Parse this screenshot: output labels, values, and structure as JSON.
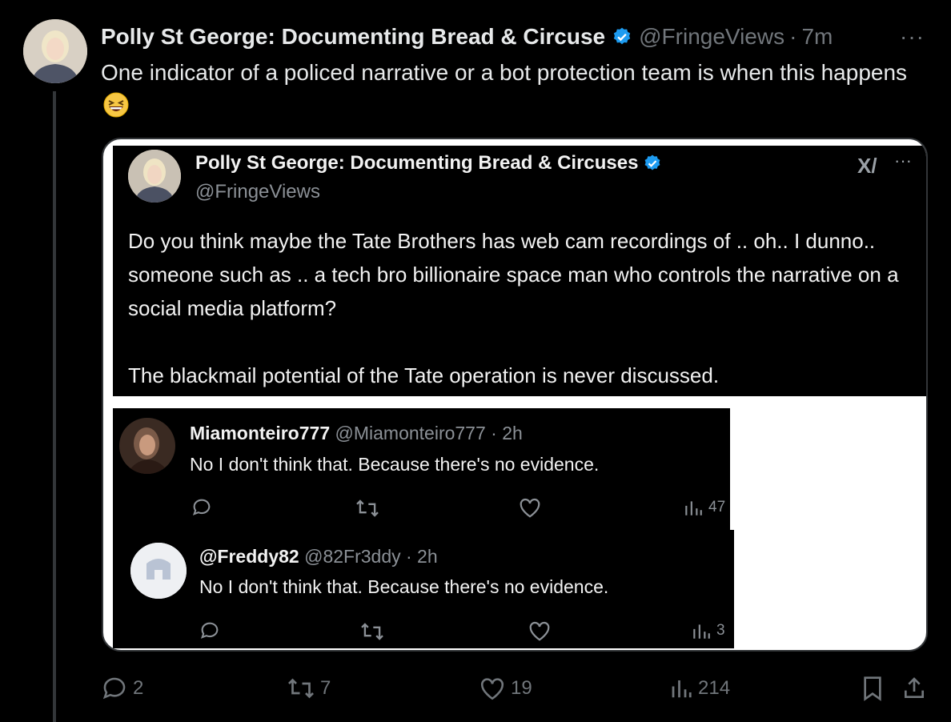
{
  "tweet": {
    "author_name": "Polly St George: Documenting Bread & Circuse",
    "author_handle": "@FringeViews",
    "separator": "·",
    "time": "7m",
    "more": "···",
    "text": "One indicator of a policed narrative or a bot protection team is when this happens",
    "emoji": "grinning-squinting-face"
  },
  "media": {
    "quoted": {
      "name": "Polly St George: Documenting Bread & Circuses",
      "handle": "@FringeViews",
      "grok_label": "X/",
      "more": "···",
      "paragraph1": "Do you think maybe the Tate Brothers has web cam recordings of .. oh.. I dunno.. someone such as .. a tech bro billionaire space man who controls the narrative on a social media platform?",
      "paragraph2": "The blackmail potential of the Tate operation is never discussed."
    },
    "reply1": {
      "name": "Miamonteiro777",
      "handle_time": "@Miamonteiro777 · 2h",
      "text": "No I don't think that.  Because there's no evidence.",
      "views": "47"
    },
    "reply2": {
      "name": "@Freddy82",
      "handle_time": "@82Fr3ddy · 2h",
      "text": "No I don't think that.  Because there's no evidence.",
      "views": "3"
    }
  },
  "actions": {
    "replies": "2",
    "reposts": "7",
    "likes": "19",
    "views": "214"
  },
  "colors": {
    "background": "#000000",
    "text": "#e7e9ea",
    "muted": "#71767b",
    "verified": "#1d9bf0",
    "border": "#333639"
  }
}
